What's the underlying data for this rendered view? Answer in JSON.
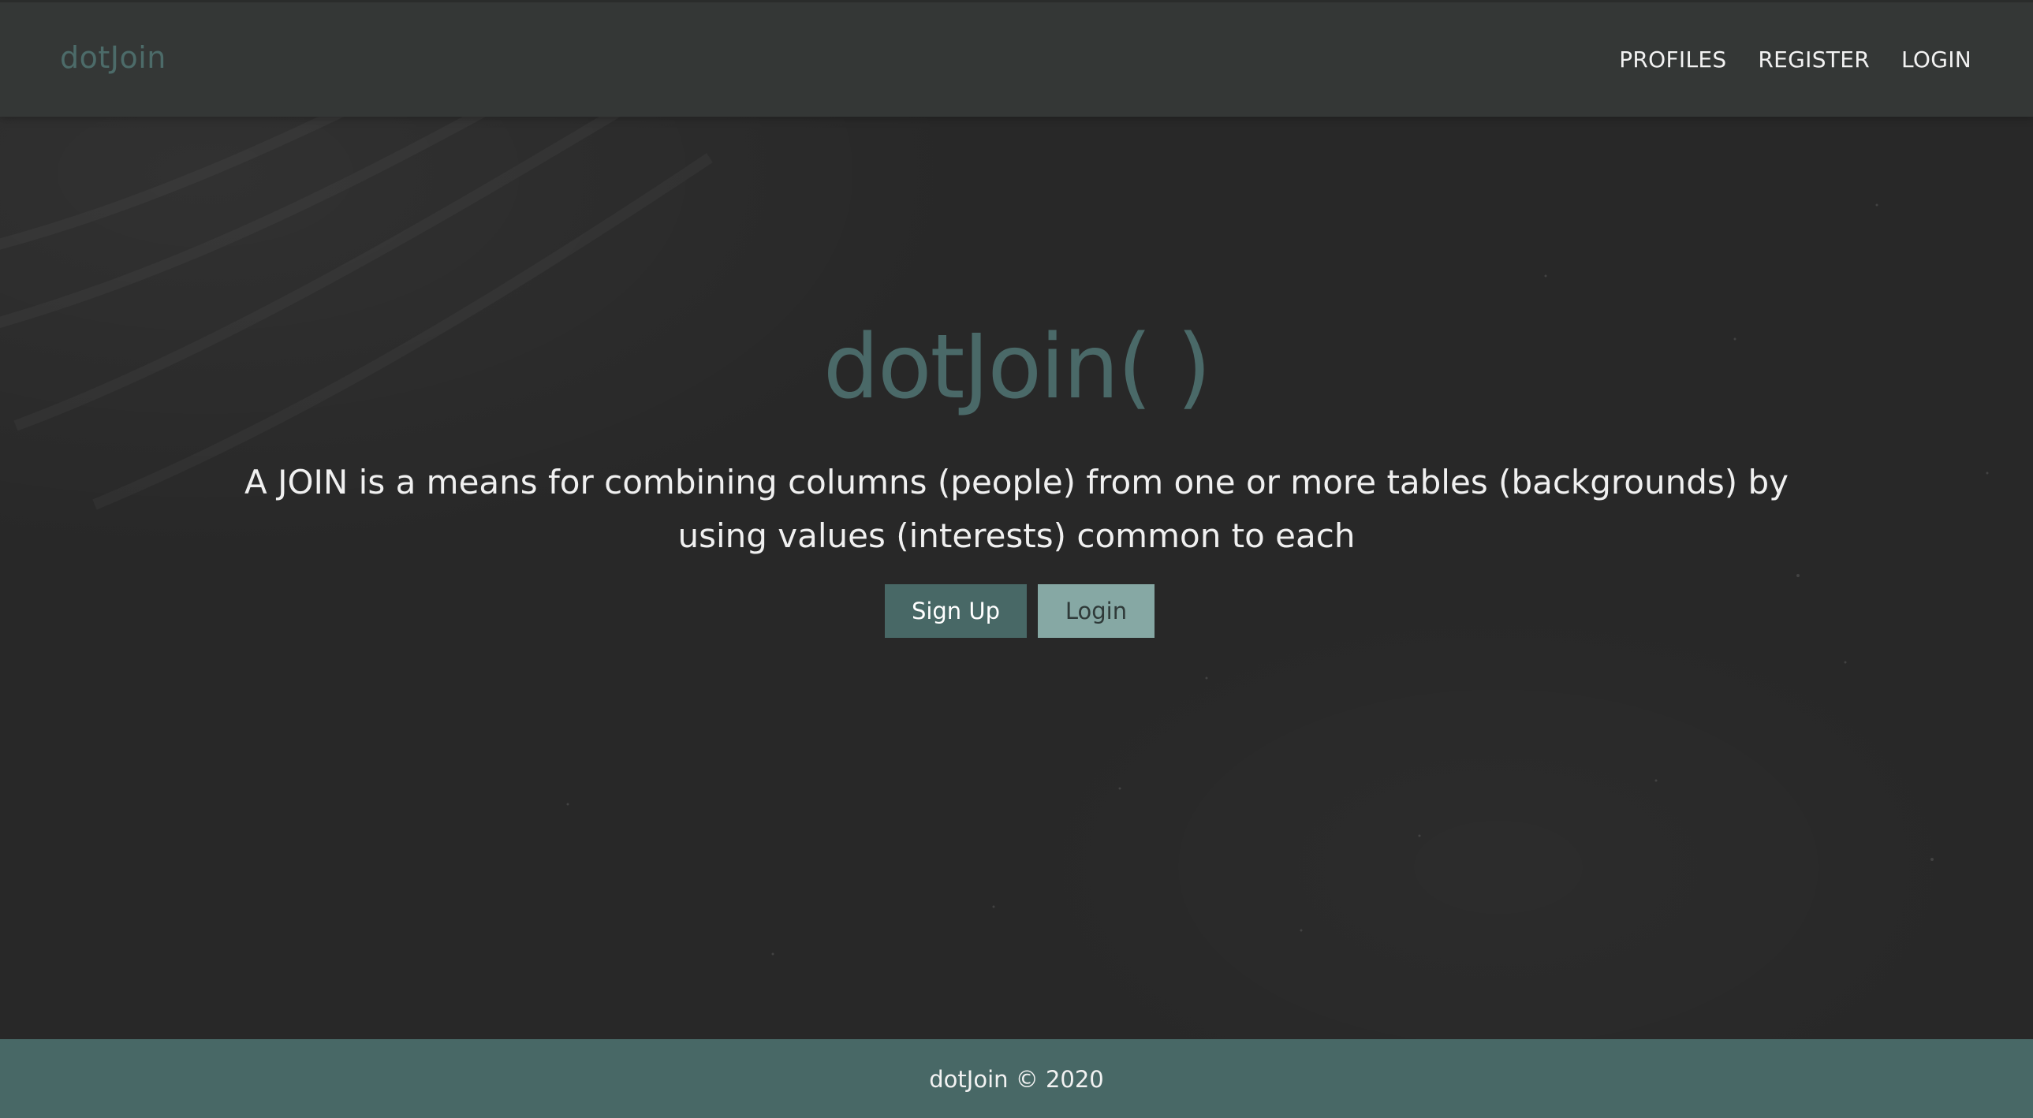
{
  "navbar": {
    "brand": "dotJoin",
    "links": [
      {
        "label": "PROFILES"
      },
      {
        "label": "REGISTER"
      },
      {
        "label": "LOGIN"
      }
    ]
  },
  "hero": {
    "title": "dotJoin( )",
    "description": "A JOIN is a means for combining columns (people) from one or more tables (backgrounds) by using values (interests) common to each",
    "signup_label": "Sign Up",
    "login_label": "Login"
  },
  "footer": {
    "text": "dotJoin © 2020"
  },
  "colors": {
    "navbar_bg": "#343736",
    "page_bg": "#282828",
    "accent": "#486866",
    "accent_light": "#86a8a4",
    "brand_text": "#4c6b69"
  }
}
